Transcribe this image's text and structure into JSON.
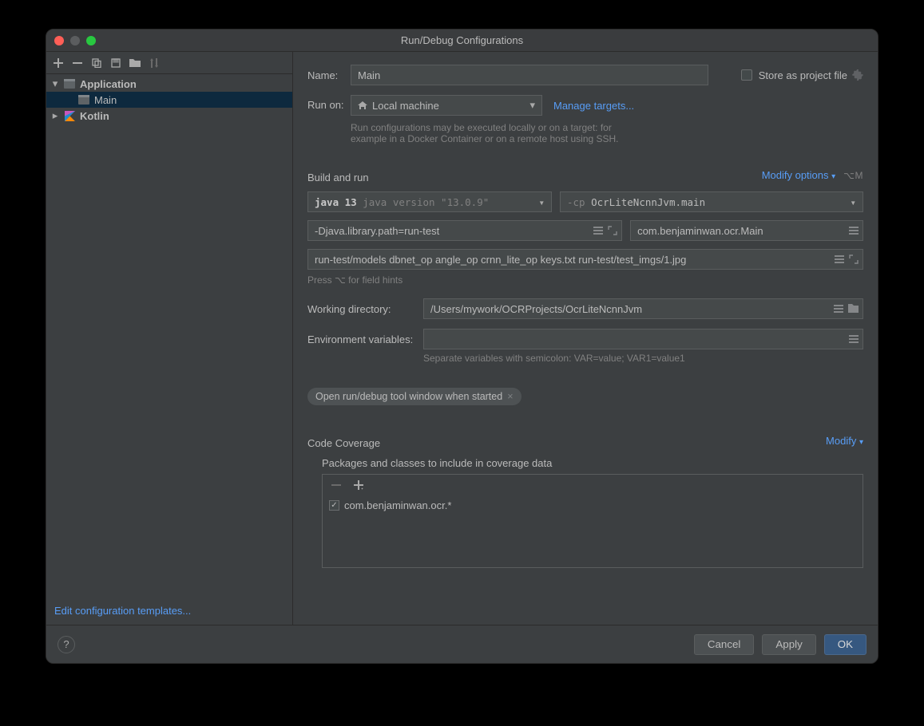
{
  "title": "Run/Debug Configurations",
  "sidebar": {
    "nodes": {
      "application": {
        "label": "Application",
        "child": "Main"
      },
      "kotlin": {
        "label": "Kotlin"
      }
    },
    "footer_link": "Edit configuration templates..."
  },
  "form": {
    "name_label": "Name:",
    "name_value": "Main",
    "store_label": "Store as project file",
    "run_on_label": "Run on:",
    "run_on_value": "Local machine",
    "manage_targets": "Manage targets...",
    "run_on_hint": "Run configurations may be executed locally or on a target: for example in a Docker Container or on a remote host using SSH.",
    "section_build_run": "Build and run",
    "modify_options": "Modify options",
    "modify_options_kbd": "⌥M",
    "jdk_strong": "java 13",
    "jdk_version": "java version \"13.0.9\"",
    "cp_prefix": "-cp",
    "cp_value": "OcrLiteNcnnJvm.main",
    "vm_options": "-Djava.library.path=run-test",
    "main_class": "com.benjaminwan.ocr.Main",
    "program_args": "run-test/models dbnet_op angle_op crnn_lite_op keys.txt run-test/test_imgs/1.jpg",
    "field_hints": "Press ⌥ for field hints",
    "working_dir_label": "Working directory:",
    "working_dir_value": "/Users/mywork/OCRProjects/OcrLiteNcnnJvm",
    "env_label": "Environment variables:",
    "env_value": "",
    "env_hint": "Separate variables with semicolon: VAR=value; VAR1=value1",
    "tag_open_tool": "Open run/debug tool window when started",
    "section_coverage": "Code Coverage",
    "modify": "Modify",
    "coverage_sub": "Packages and classes to include in coverage data",
    "coverage_item": "com.benjaminwan.ocr.*"
  },
  "footer": {
    "cancel": "Cancel",
    "apply": "Apply",
    "ok": "OK"
  }
}
